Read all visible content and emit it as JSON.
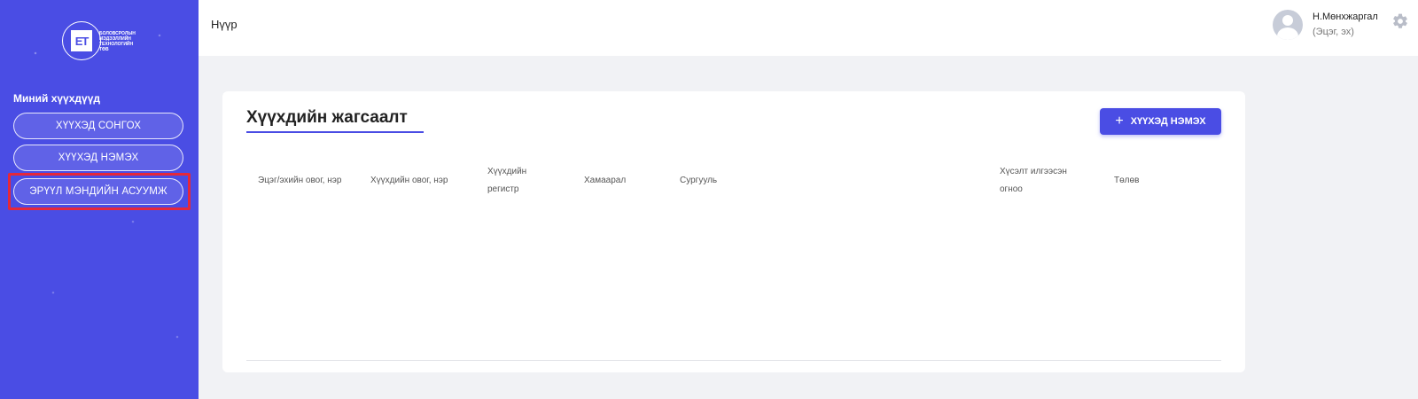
{
  "sidebar": {
    "logo": {
      "mark": "ЕТ",
      "text_lines": [
        "БОЛОВСРОЛЫН",
        "МЭДЭЭЛЛИЙН",
        "ТЕХНОЛОГИЙН",
        "ТӨВ"
      ]
    },
    "section_title": "Миний хүүхдүүд",
    "items": [
      {
        "label": "ХҮҮХЭД СОНГОХ"
      },
      {
        "label": "ХҮҮХЭД НЭМЭХ"
      },
      {
        "label": "ЭРҮҮЛ МЭНДИЙН АСУУМЖ"
      }
    ],
    "highlight_color": "#e5283a"
  },
  "header": {
    "title": "Нүүр",
    "user": {
      "name": "Н.Мөнхжаргал",
      "role": "(Эцэг, эх)"
    },
    "icons": [
      "avatar-icon",
      "gear-icon"
    ]
  },
  "main": {
    "card_title": "Хүүхдийн жагсаалт",
    "add_button_label": "ХҮҮХЭД НЭМЭХ",
    "table": {
      "columns": [
        {
          "line1": "Эцэг/эхийн овог, нэр",
          "line2": ""
        },
        {
          "line1": "Хүүхдийн овог, нэр",
          "line2": ""
        },
        {
          "line1": "Хүүхдийн",
          "line2": "регистр"
        },
        {
          "line1": "Хамаарал",
          "line2": ""
        },
        {
          "line1": "Сургууль",
          "line2": ""
        },
        {
          "line1": "Хүсэлт илгээсэн",
          "line2": "огноо"
        },
        {
          "line1": "Төлөв",
          "line2": ""
        }
      ],
      "rows": []
    }
  },
  "colors": {
    "accent": "#4a4de4",
    "background": "#f1f2f5"
  }
}
